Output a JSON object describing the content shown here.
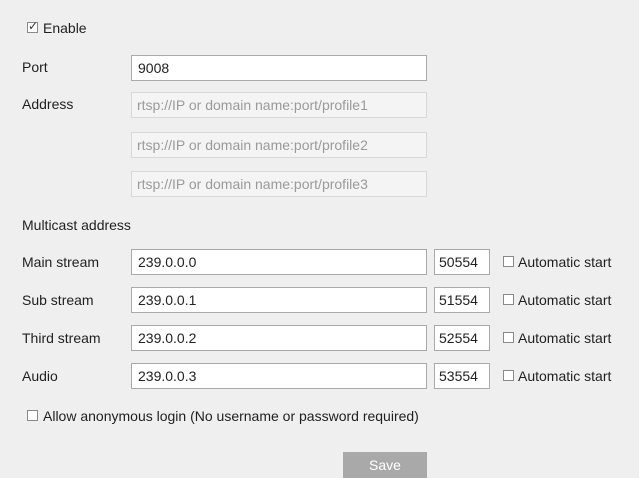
{
  "enable": {
    "label": "Enable",
    "checked": true
  },
  "port": {
    "label": "Port",
    "value": "9008"
  },
  "address": {
    "label": "Address",
    "fields": [
      "rtsp://IP or domain name:port/profile1",
      "rtsp://IP or domain name:port/profile2",
      "rtsp://IP or domain name:port/profile3"
    ]
  },
  "multicast": {
    "heading": "Multicast address",
    "rows": [
      {
        "label": "Main stream",
        "address": "239.0.0.0",
        "port": "50554",
        "auto_label": "Automatic start"
      },
      {
        "label": "Sub stream",
        "address": "239.0.0.1",
        "port": "51554",
        "auto_label": "Automatic start"
      },
      {
        "label": "Third stream",
        "address": "239.0.0.2",
        "port": "52554",
        "auto_label": "Automatic start"
      },
      {
        "label": "Audio",
        "address": "239.0.0.3",
        "port": "53554",
        "auto_label": "Automatic start"
      }
    ]
  },
  "anonymous": {
    "label": "Allow anonymous login (No username or password required)",
    "checked": false
  },
  "save_label": "Save"
}
